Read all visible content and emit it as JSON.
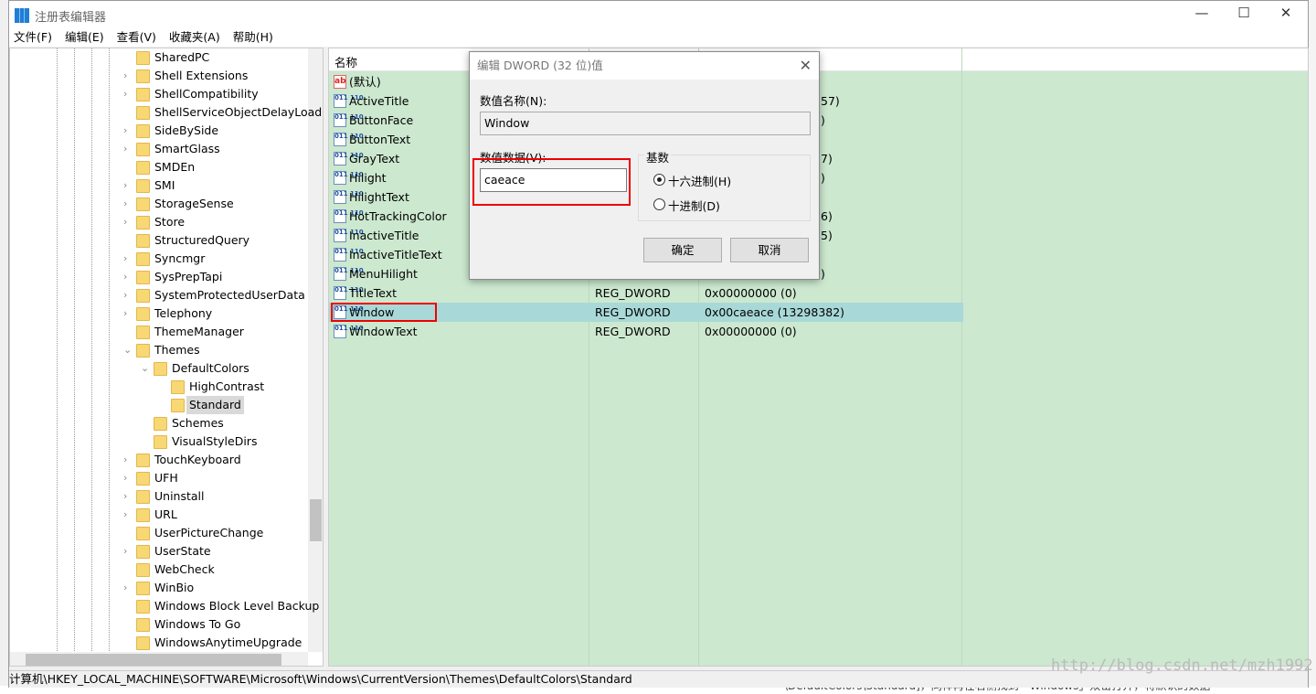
{
  "window": {
    "title": "注册表编辑器",
    "minimize": "—",
    "maximize": "☐",
    "close": "✕"
  },
  "menu": [
    "文件(F)",
    "编辑(E)",
    "查看(V)",
    "收藏夹(A)",
    "帮助(H)"
  ],
  "tree": [
    {
      "label": "SharedPC",
      "level": 0,
      "expander": ""
    },
    {
      "label": "Shell Extensions",
      "level": 0,
      "expander": ">"
    },
    {
      "label": "ShellCompatibility",
      "level": 0,
      "expander": ">"
    },
    {
      "label": "ShellServiceObjectDelayLoad",
      "level": 0,
      "expander": ""
    },
    {
      "label": "SideBySide",
      "level": 0,
      "expander": ">"
    },
    {
      "label": "SmartGlass",
      "level": 0,
      "expander": ">"
    },
    {
      "label": "SMDEn",
      "level": 0,
      "expander": ""
    },
    {
      "label": "SMI",
      "level": 0,
      "expander": ">"
    },
    {
      "label": "StorageSense",
      "level": 0,
      "expander": ">"
    },
    {
      "label": "Store",
      "level": 0,
      "expander": ">"
    },
    {
      "label": "StructuredQuery",
      "level": 0,
      "expander": ""
    },
    {
      "label": "Syncmgr",
      "level": 0,
      "expander": ">"
    },
    {
      "label": "SysPrepTapi",
      "level": 0,
      "expander": ">"
    },
    {
      "label": "SystemProtectedUserData",
      "level": 0,
      "expander": ">"
    },
    {
      "label": "Telephony",
      "level": 0,
      "expander": ">"
    },
    {
      "label": "ThemeManager",
      "level": 0,
      "expander": ""
    },
    {
      "label": "Themes",
      "level": 0,
      "expander": "v"
    },
    {
      "label": "DefaultColors",
      "level": 1,
      "expander": "v"
    },
    {
      "label": "HighContrast",
      "level": 2,
      "expander": ""
    },
    {
      "label": "Standard",
      "level": 2,
      "expander": "",
      "selected": true
    },
    {
      "label": "Schemes",
      "level": 1,
      "expander": ""
    },
    {
      "label": "VisualStyleDirs",
      "level": 1,
      "expander": ""
    },
    {
      "label": "TouchKeyboard",
      "level": 0,
      "expander": ">"
    },
    {
      "label": "UFH",
      "level": 0,
      "expander": ">"
    },
    {
      "label": "Uninstall",
      "level": 0,
      "expander": ">"
    },
    {
      "label": "URL",
      "level": 0,
      "expander": ">"
    },
    {
      "label": "UserPictureChange",
      "level": 0,
      "expander": ""
    },
    {
      "label": "UserState",
      "level": 0,
      "expander": ">"
    },
    {
      "label": "WebCheck",
      "level": 0,
      "expander": ""
    },
    {
      "label": "WinBio",
      "level": 0,
      "expander": ">"
    },
    {
      "label": "Windows Block Level Backup",
      "level": 0,
      "expander": ""
    },
    {
      "label": "Windows To Go",
      "level": 0,
      "expander": ""
    },
    {
      "label": "WindowsAnytimeUpgrade",
      "level": 0,
      "expander": ""
    }
  ],
  "list": {
    "header_name": "名称",
    "rows": [
      {
        "name": "(默认)",
        "icon": "string-value-icon",
        "type": "",
        "data": ""
      },
      {
        "name": "ActiveTitle",
        "icon": "dword-value-icon",
        "type": "",
        "data": "57)"
      },
      {
        "name": "ButtonFace",
        "icon": "dword-value-icon",
        "type": "",
        "data": ")"
      },
      {
        "name": "ButtonText",
        "icon": "dword-value-icon",
        "type": "",
        "data": ""
      },
      {
        "name": "GrayText",
        "icon": "dword-value-icon",
        "type": "",
        "data": "7)"
      },
      {
        "name": "Hilight",
        "icon": "dword-value-icon",
        "type": "",
        "data": ")"
      },
      {
        "name": "HilightText",
        "icon": "dword-value-icon",
        "type": "",
        "data": ""
      },
      {
        "name": "HotTrackingColor",
        "icon": "dword-value-icon",
        "type": "",
        "data": "6)"
      },
      {
        "name": "InactiveTitle",
        "icon": "dword-value-icon",
        "type": "",
        "data": "5)"
      },
      {
        "name": "InactiveTitleText",
        "icon": "dword-value-icon",
        "type": "",
        "data": ""
      },
      {
        "name": "MenuHilight",
        "icon": "dword-value-icon",
        "type": "",
        "data": ")"
      },
      {
        "name": "TitleText",
        "icon": "dword-value-icon",
        "type": "REG_DWORD",
        "data": "0x00000000 (0)"
      },
      {
        "name": "Window",
        "icon": "dword-value-icon",
        "type": "REG_DWORD",
        "data": "0x00caeace (13298382)",
        "selected": true
      },
      {
        "name": "WindowText",
        "icon": "dword-value-icon",
        "type": "REG_DWORD",
        "data": "0x00000000 (0)"
      }
    ]
  },
  "status_path": "计算机\\HKEY_LOCAL_MACHINE\\SOFTWARE\\Microsoft\\Windows\\CurrentVersion\\Themes\\DefaultColors\\Standard",
  "dialog": {
    "title": "编辑 DWORD (32 位)值",
    "close": "✕",
    "name_label": "数值名称(N):",
    "name_value": "Window",
    "data_label": "数值数据(V):",
    "data_value": "caeace",
    "base_label": "基数",
    "hex_label": "十六进制(H)",
    "dec_label": "十进制(D)",
    "base_selected": "hex",
    "ok": "确定",
    "cancel": "取消"
  },
  "watermark": "http://blog.csdn.net/mzh1992",
  "background_text": "\\DefaultColors\\Standard]，同样再在右侧找到「Windows」双击打开，将默认的数据"
}
